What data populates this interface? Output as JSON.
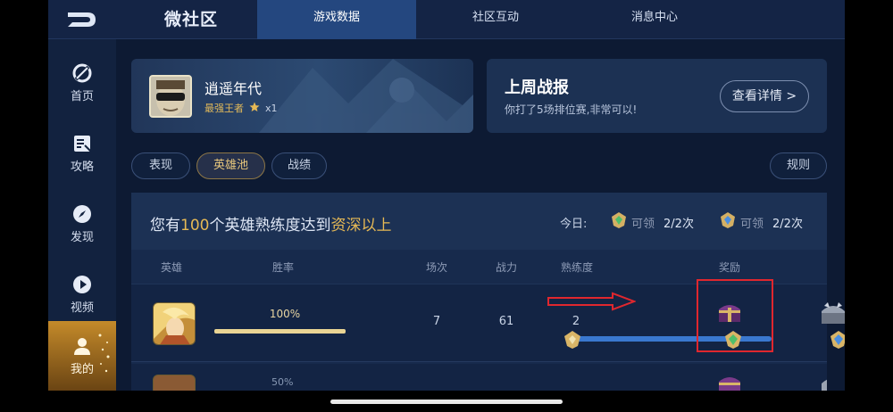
{
  "app": {
    "title": "微社区"
  },
  "tabs": [
    {
      "label": "游戏数据",
      "active": true
    },
    {
      "label": "社区互动",
      "active": false
    },
    {
      "label": "消息中心",
      "active": false
    }
  ],
  "sidebar": {
    "items": [
      {
        "label": "首页",
        "icon": "home-icon",
        "active": false
      },
      {
        "label": "攻略",
        "icon": "guide-icon",
        "active": false
      },
      {
        "label": "发现",
        "icon": "compass-icon",
        "active": false
      },
      {
        "label": "视频",
        "icon": "play-icon",
        "active": false
      },
      {
        "label": "我的",
        "icon": "user-icon",
        "active": true
      }
    ]
  },
  "profile": {
    "name": "逍遥年代",
    "rank": "最强王者",
    "star_count": "x1"
  },
  "weekly": {
    "title": "上周战报",
    "subtitle": "你打了5场排位赛,非常可以!",
    "detail_label": "查看详情 >"
  },
  "filters": {
    "chips": [
      "表现",
      "英雄池",
      "战绩"
    ],
    "active_index": 1,
    "rules_label": "规则"
  },
  "summary": {
    "prefix": "您有",
    "count": "100",
    "middle": "个英雄熟练度达到",
    "level": "资深以上",
    "today_label": "今日:",
    "claims": [
      {
        "can": "可领",
        "count": "2/2次"
      },
      {
        "can": "可领",
        "count": "2/2次"
      }
    ]
  },
  "table": {
    "columns": [
      "英雄",
      "胜率",
      "场次",
      "战力",
      "熟练度",
      "奖励"
    ],
    "rows": [
      {
        "win_rate_text": "100%",
        "win_rate": 1.0,
        "games": "7",
        "power": "61",
        "proficiency": "2"
      }
    ],
    "partial_row_win_rate_text": "50%"
  },
  "colors": {
    "accent_gold": "#e6b955",
    "progress_blue": "#3a78cf",
    "annotation_red": "#e0272e"
  }
}
